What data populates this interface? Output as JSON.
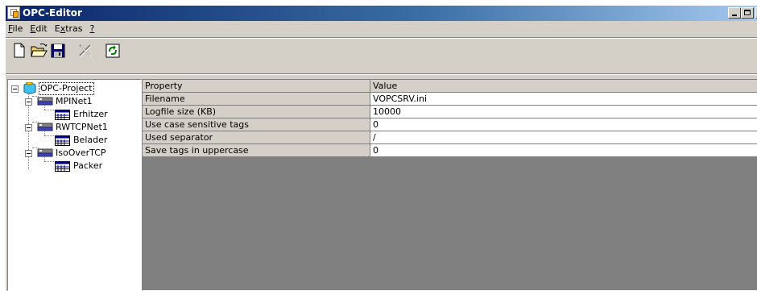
{
  "window": {
    "title": "OPC-Editor",
    "controls": {
      "minimize": "_",
      "maximize": "□",
      "close": "X"
    }
  },
  "menu": [
    {
      "key": "F",
      "rest": "ile"
    },
    {
      "key": "E",
      "rest": "dit"
    },
    {
      "pre": "E",
      "key": "x",
      "rest": "tras"
    },
    {
      "key": "?",
      "rest": ""
    }
  ],
  "toolbar": {
    "buttons": [
      "new-file-icon",
      "open-folder-icon",
      "save-icon",
      "delete-icon",
      "refresh-icon"
    ]
  },
  "tree": [
    {
      "label": "OPC-Project",
      "icon": "project-icon",
      "level": 0,
      "expanded": true,
      "selected": true
    },
    {
      "label": "MPINet1",
      "icon": "network-icon",
      "level": 1,
      "expanded": true
    },
    {
      "label": "Erhitzer",
      "icon": "device-icon",
      "level": 2
    },
    {
      "label": "RWTCPNet1",
      "icon": "network-icon",
      "level": 1,
      "expanded": true
    },
    {
      "label": "Belader",
      "icon": "device-icon",
      "level": 2
    },
    {
      "label": "IsoOverTCP",
      "icon": "network-icon",
      "level": 1,
      "expanded": true
    },
    {
      "label": "Packer",
      "icon": "device-icon",
      "level": 2
    }
  ],
  "grid": {
    "headers": [
      "Property",
      "Value"
    ],
    "rows": [
      [
        "Filename",
        "VOPCSRV.ini"
      ],
      [
        "Logfile size (KB)",
        "10000"
      ],
      [
        "Use case sensitive tags",
        "0"
      ],
      [
        "Used separator",
        "/"
      ],
      [
        "Save tags in uppercase",
        "0"
      ]
    ]
  }
}
